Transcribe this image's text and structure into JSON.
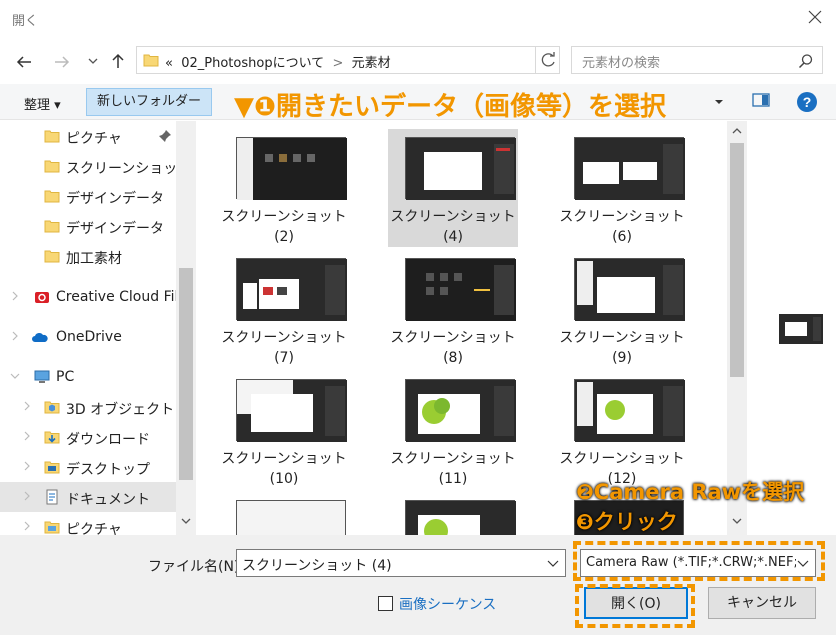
{
  "window": {
    "title": "開く"
  },
  "address": {
    "prefix": "«",
    "crumbs": [
      "02_Photoshopについて",
      "元素材"
    ]
  },
  "search": {
    "placeholder": "元素材の検索"
  },
  "toolbar": {
    "organize": "整理 ▾",
    "new_folder": "新しいフォルダー"
  },
  "annotations": {
    "step1": "▼❶開きたいデータ（画像等）を選択",
    "step2": "❷Camera Rawを選択",
    "step3": "❸クリック",
    "color": "#f29600"
  },
  "sidebar": {
    "items": [
      {
        "label": "ピクチャ",
        "icon": "folder-icon"
      },
      {
        "label": "スクリーンショット",
        "icon": "folder-icon"
      },
      {
        "label": "デザインデータ",
        "icon": "folder-icon"
      },
      {
        "label": "デザインデータ",
        "icon": "folder-icon"
      },
      {
        "label": "加工素材",
        "icon": "folder-icon"
      },
      {
        "label": "Creative Cloud Files",
        "icon": "creative-cloud-icon"
      },
      {
        "label": "OneDrive",
        "icon": "onedrive-icon"
      },
      {
        "label": "PC",
        "icon": "pc-icon"
      },
      {
        "label": "3D オブジェクト",
        "icon": "3d-objects-icon"
      },
      {
        "label": "ダウンロード",
        "icon": "download-icon"
      },
      {
        "label": "デスクトップ",
        "icon": "desktop-icon"
      },
      {
        "label": "ドキュメント",
        "icon": "document-icon"
      },
      {
        "label": "ピクチャ",
        "icon": "pictures-icon"
      }
    ]
  },
  "files": [
    {
      "name": "スクリーンショット",
      "num": "(2)"
    },
    {
      "name": "スクリーンショット",
      "num": "(4)"
    },
    {
      "name": "スクリーンショット",
      "num": "(6)"
    },
    {
      "name": "スクリーンショット",
      "num": "(7)"
    },
    {
      "name": "スクリーンショット",
      "num": "(8)"
    },
    {
      "name": "スクリーンショット",
      "num": "(9)"
    },
    {
      "name": "スクリーンショット",
      "num": "(10)"
    },
    {
      "name": "スクリーンショット",
      "num": "(11)"
    },
    {
      "name": "スクリーンショット",
      "num": "(12)"
    }
  ],
  "footer": {
    "filename_label": "ファイル名(N):",
    "filename_value": "スクリーンショット (4)",
    "filetype_value": "Camera Raw (*.TIF;*.CRW;*.NEF;*.RAF;*.ORF;*.MRW;*.DCR;*.MOS",
    "sequence_label": "画像シーケンス",
    "open_label": "開く(O)",
    "cancel_label": "キャンセル"
  }
}
